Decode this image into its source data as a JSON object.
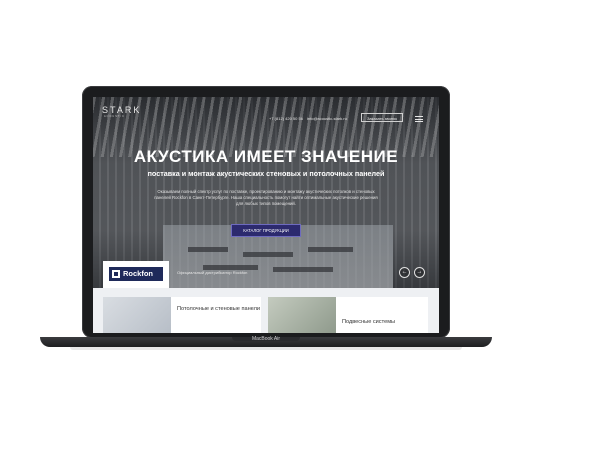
{
  "device": {
    "brand": "MacBook Air"
  },
  "header": {
    "logo": "STARK",
    "logo_sub": "ACOUSTIC",
    "phone": "+7 (812) 420 50 56",
    "email": "info@acoustic-stark.ru",
    "call_button": "Заказать звонок",
    "menu_icon": "hamburger-icon"
  },
  "hero": {
    "title": "АКУСТИКА ИМЕЕТ ЗНАЧЕНИЕ",
    "subtitle": "поставка и монтаж акустических стеновых и потолочных панелей",
    "description": "Оказываем полный спектр услуг по поставке, проектированию и монтажу акустических потолков и стеновых панелей Rockfon в Санкт-Петербурге. Наша специальность помогут найти оптимальные акустические решения для любых типов помещений.",
    "catalog_button": "КАТАЛОГ ПРОДУКЦИИ",
    "partner_logo": "Rockfon",
    "partner_text": "Официальный дистрибьютор Rockfon",
    "prev_icon": "arrow-left-icon",
    "next_icon": "arrow-right-icon",
    "prev_glyph": "←",
    "next_glyph": "→"
  },
  "categories": [
    {
      "label": "Потолочные и стеновые панели"
    },
    {
      "label": "Подвесные системы"
    }
  ],
  "colors": {
    "accent": "#2c2a6e",
    "rockfon": "#1f2a5a",
    "bezel": "#1b1c1e"
  }
}
